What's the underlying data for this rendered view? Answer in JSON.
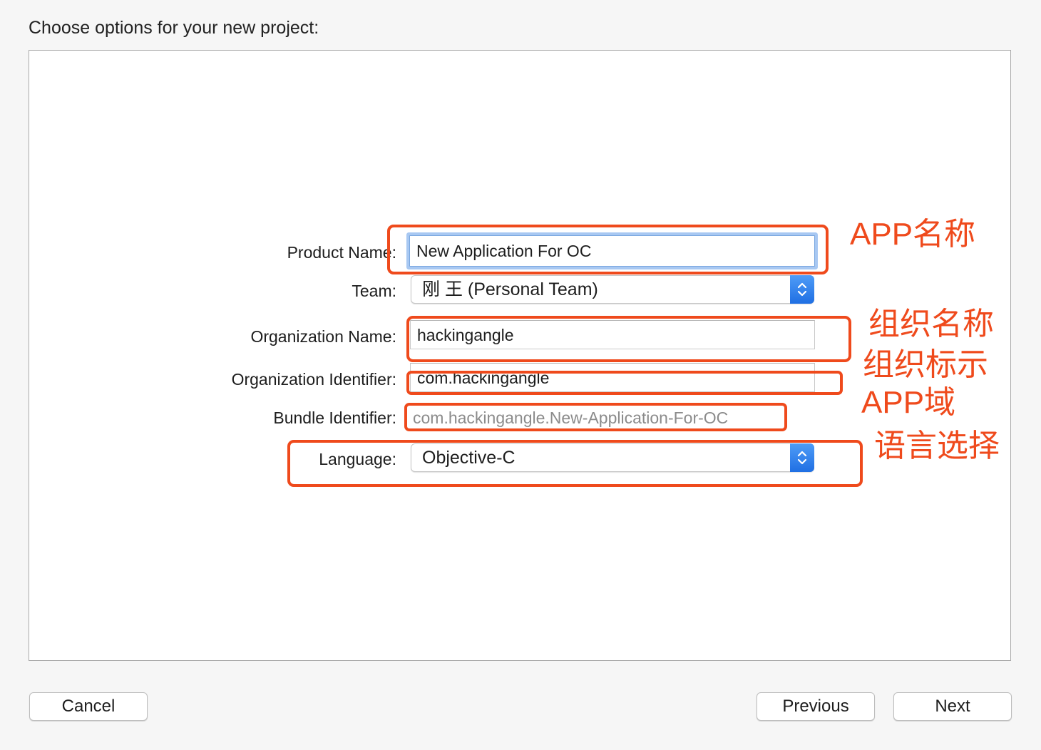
{
  "header": {
    "title": "Choose options for your new project:"
  },
  "form": {
    "product_name": {
      "label": "Product Name:",
      "value": "New Application For OC"
    },
    "team": {
      "label": "Team:",
      "value": "刚 王 (Personal Team)"
    },
    "organization_name": {
      "label": "Organization Name:",
      "value": "hackingangle"
    },
    "organization_identifier": {
      "label": "Organization Identifier:",
      "value": "com.hackingangle"
    },
    "bundle_identifier": {
      "label": "Bundle Identifier:",
      "value": "com.hackingangle.New-Application-For-OC"
    },
    "language": {
      "label": "Language:",
      "value": "Objective-C"
    }
  },
  "annotations": {
    "app_name": "APP名称",
    "org_name": "组织名称",
    "org_identifier": "组织标示",
    "app_domain": "APP域",
    "language_select": "语言选择",
    "color": "#ef4a1c"
  },
  "footer": {
    "cancel_label": "Cancel",
    "previous_label": "Previous",
    "next_label": "Next"
  },
  "icons": {
    "popup_stepper": "up-down-chevron-icon"
  }
}
